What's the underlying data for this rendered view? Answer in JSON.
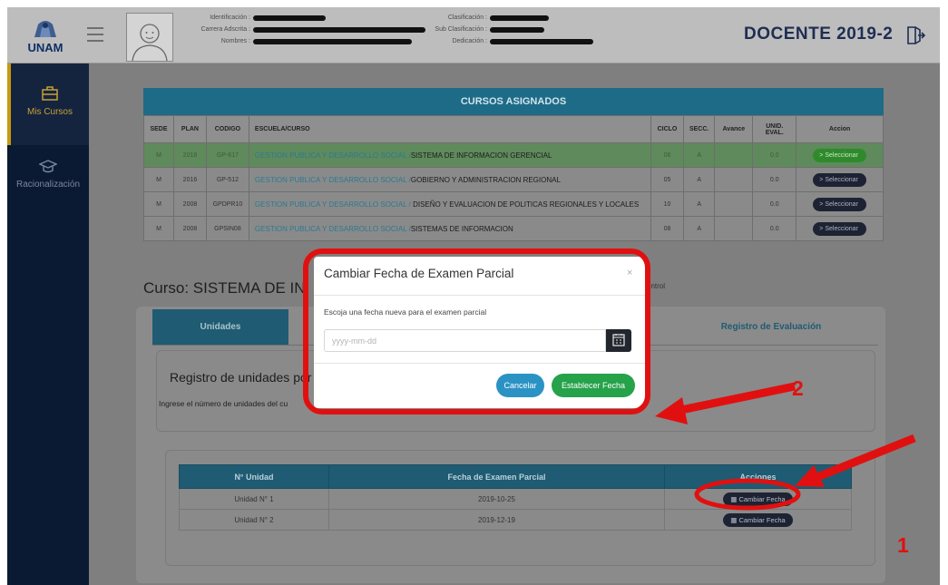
{
  "header": {
    "logo_text": "UNAM",
    "title": "DOCENTE 2019-2",
    "fields_left": [
      "Identificación :",
      "Carrera Adscrita :",
      "Nombres :"
    ],
    "fields_right": [
      "Clasificación :",
      "Sub Clasificación :",
      "Dedicación :"
    ]
  },
  "sidebar": {
    "items": [
      {
        "label": "Mis Cursos",
        "icon": "briefcase-icon"
      },
      {
        "label": "Racionalización",
        "icon": "graduation-cap-icon"
      }
    ]
  },
  "courses": {
    "title": "CURSOS ASIGNADOS",
    "columns": [
      "SEDE",
      "PLAN",
      "CODIGO",
      "ESCUELA/CURSO",
      "CICLO",
      "SECC.",
      "Avance",
      "UNID. EVAL.",
      "Accion"
    ],
    "rows": [
      {
        "sede": "M",
        "plan": "2016",
        "codigo": "GP-617",
        "escuela": "GESTION PUBLICA Y DESARROLLO SOCIAL /",
        "curso": "SISTEMA DE INFORMACION GERENCIAL",
        "ciclo": "06",
        "secc": "A",
        "avance": "",
        "unid": "0.0",
        "accion": "Seleccionar"
      },
      {
        "sede": "M",
        "plan": "2016",
        "codigo": "GP-512",
        "escuela": "GESTION PUBLICA Y DESARROLLO SOCIAL /",
        "curso": "GOBIERNO Y ADMINISTRACION REGIONAL",
        "ciclo": "05",
        "secc": "A",
        "avance": "",
        "unid": "0.0",
        "accion": "Seleccionar"
      },
      {
        "sede": "M",
        "plan": "2008",
        "codigo": "GPDPR10",
        "escuela": "GESTION PUBLICA Y DESARROLLO SOCIAL /",
        "curso": "DISEÑO Y EVALUACION DE POLITICAS REGIONALES Y LOCALES",
        "ciclo": "10",
        "secc": "A",
        "avance": "",
        "unid": "0.0",
        "accion": "Seleccionar"
      },
      {
        "sede": "M",
        "plan": "2008",
        "codigo": "GPSIN08",
        "escuela": "GESTION PUBLICA Y DESARROLLO SOCIAL /",
        "curso": "SISTEMAS DE INFORMACION",
        "ciclo": "08",
        "secc": "A",
        "avance": "",
        "unid": "0.0",
        "accion": "Seleccionar"
      }
    ]
  },
  "curso": {
    "label": "Curso: SISTEMA DE IN",
    "label_tail": "ontrol"
  },
  "tabs": {
    "unidades": "Unidades",
    "registro": "Registro de Evaluación"
  },
  "registro": {
    "title": "Registro de unidades por",
    "subtitle": "Ingrese el número de unidades del cu"
  },
  "units": {
    "columns": [
      "N° Unidad",
      "Fecha de Examen Parcial",
      "Acciones"
    ],
    "rows": [
      {
        "unidad": "Unidad N° 1",
        "fecha": "2019-10-25",
        "accion": "Cambiar Fecha"
      },
      {
        "unidad": "Unidad N° 2",
        "fecha": "2019-12-19",
        "accion": "Cambiar Fecha"
      }
    ]
  },
  "modal": {
    "title": "Cambiar Fecha de Examen Parcial",
    "close": "×",
    "body": "Escoja una fecha nueva para el examen parcial",
    "input_placeholder": "yyyy-mm-dd",
    "cancel": "Cancelar",
    "confirm": "Establecer Fecha"
  },
  "annotations": {
    "callout_1": "1",
    "callout_2": "2",
    "color": "#e11010"
  }
}
